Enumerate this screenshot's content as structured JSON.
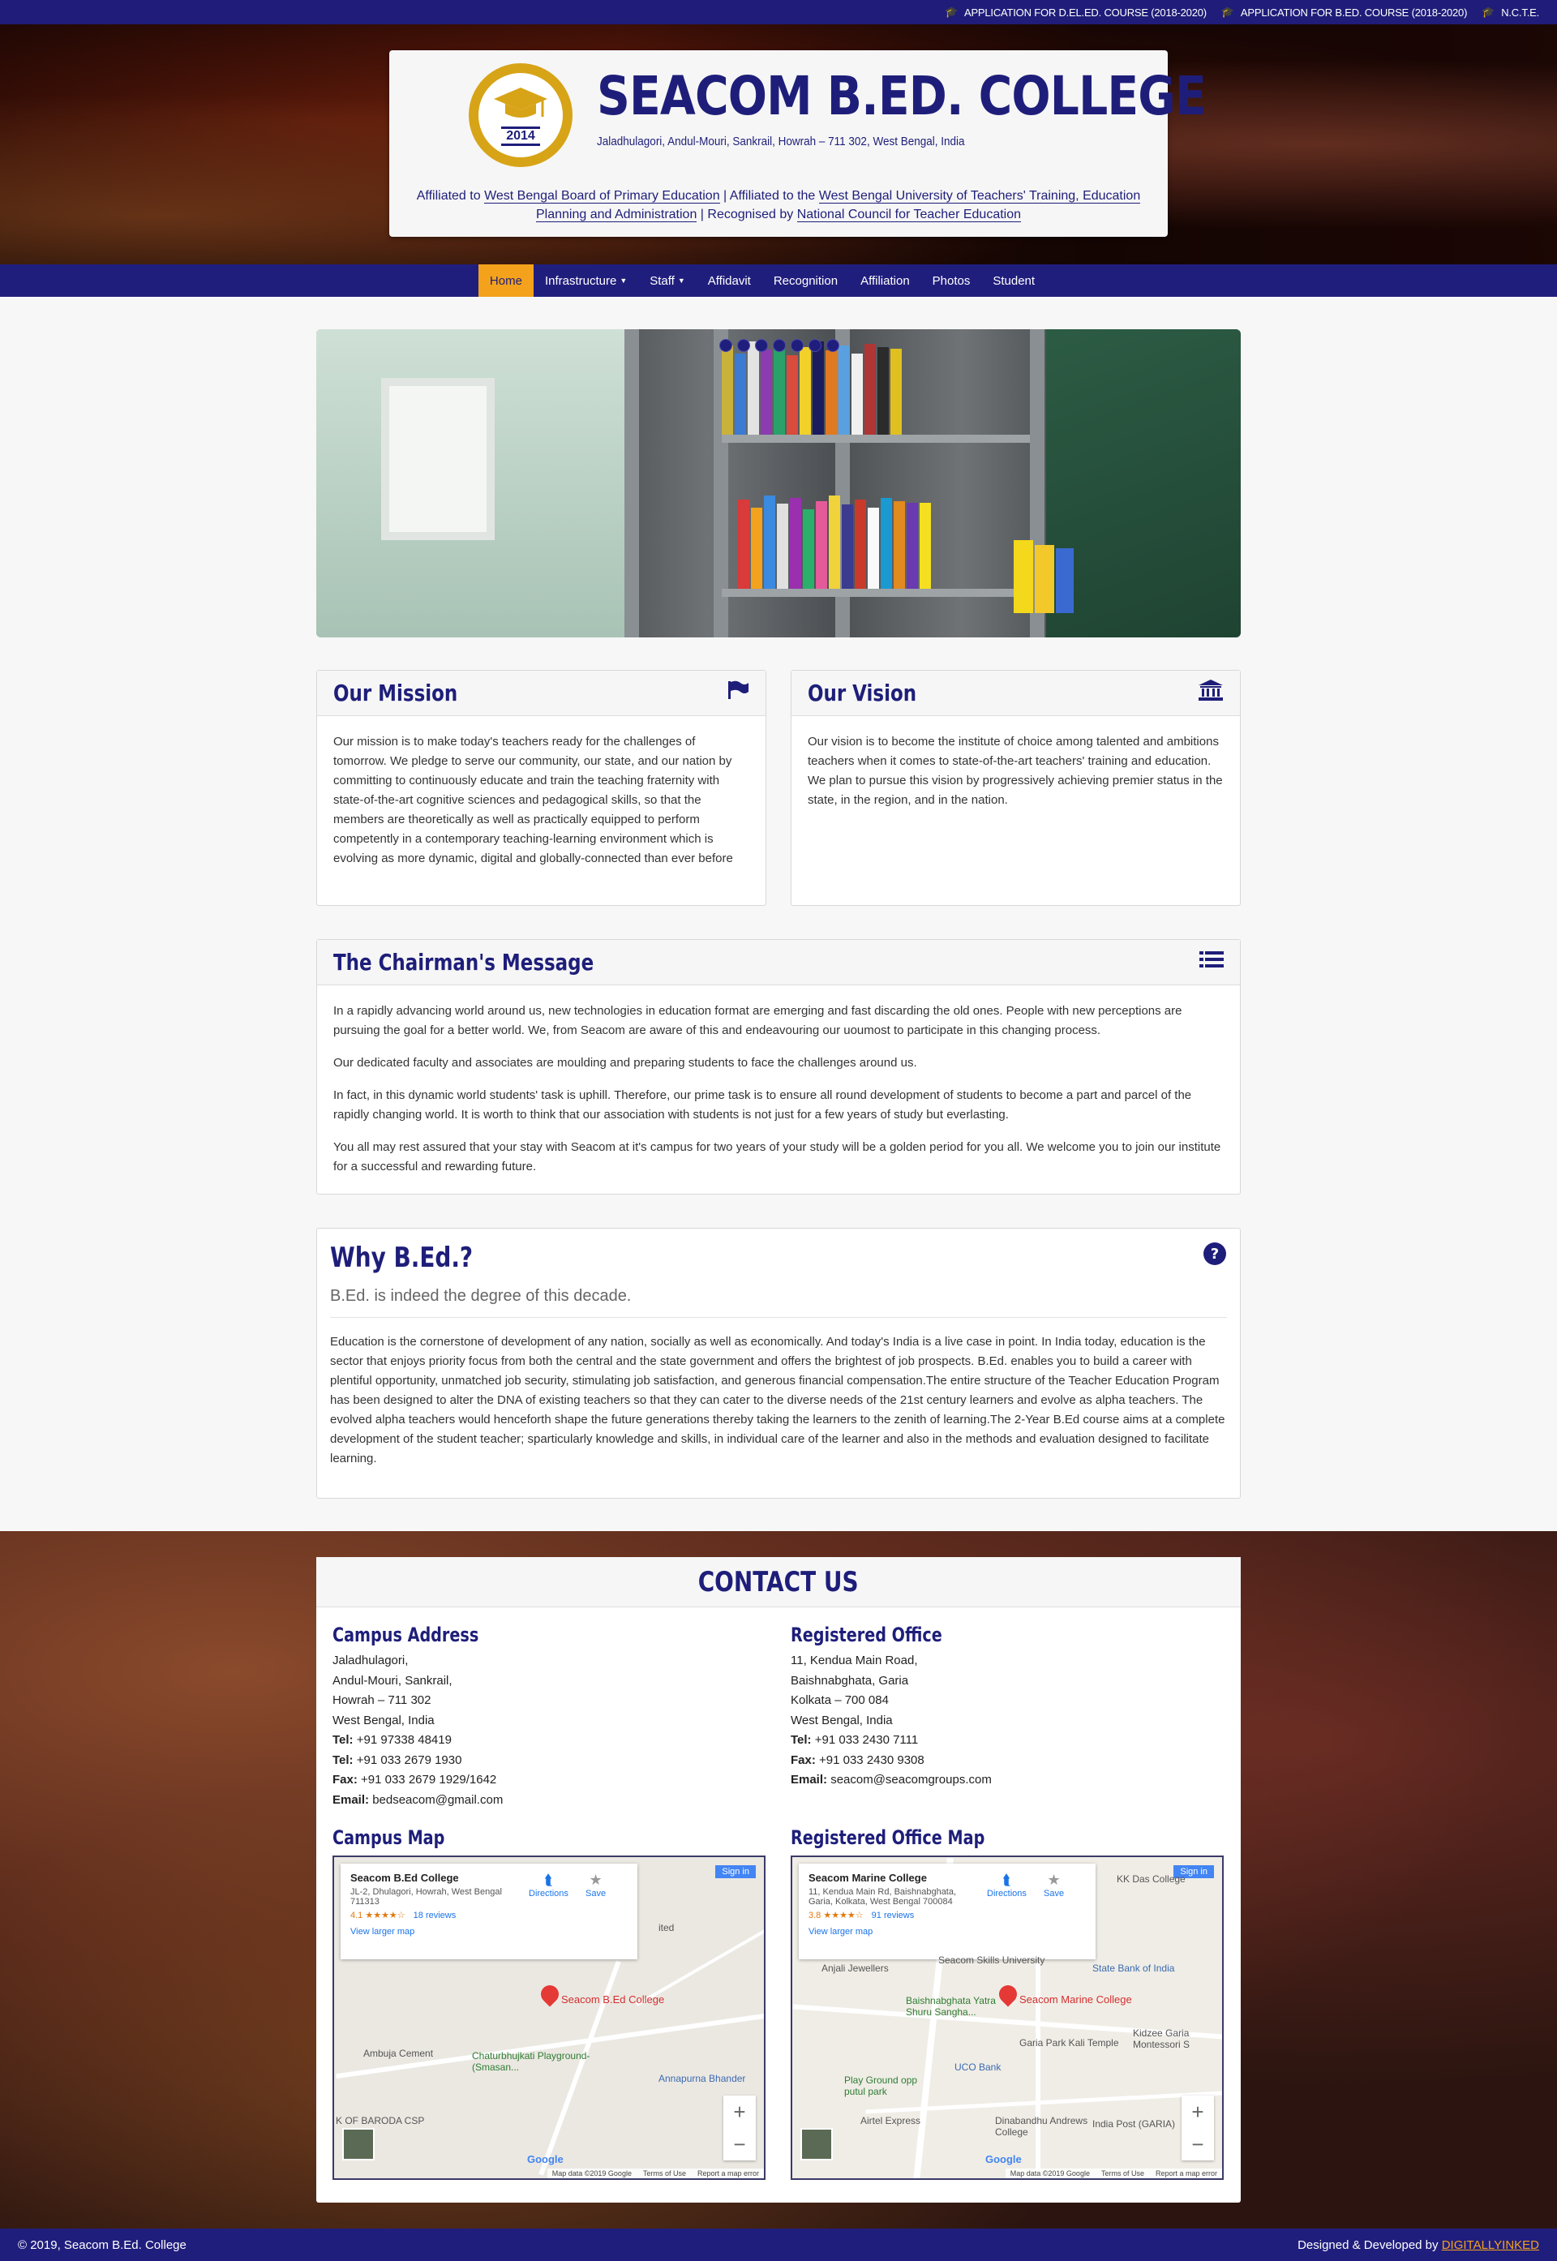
{
  "topbar": {
    "links": [
      {
        "label": "APPLICATION FOR D.EL.ED. COURSE (2018-2020)",
        "icon": "graduation-cap-icon"
      },
      {
        "label": "APPLICATION FOR B.ED. COURSE (2018-2020)",
        "icon": "graduation-cap-icon"
      },
      {
        "label": "N.C.T.E.",
        "icon": "graduation-cap-icon"
      }
    ]
  },
  "header": {
    "logo_year": "2014",
    "college_name": "SEACOM B.ED. COLLEGE",
    "address": "Jaladhulagori, Andul-Mouri, Sankrail, Howrah – 711 302, West Bengal, India",
    "affil_prefix": "Affiliated to",
    "affil_board": "West Bengal Board of Primary Education",
    "affil_mid": "| Affiliated to the",
    "affil_univ": "West Bengal University of Teachers' Training, Education Planning and Administration",
    "affil_mid2": "| Recognised by",
    "affil_council": "National Council for Teacher Education"
  },
  "nav": {
    "items": [
      {
        "label": "Home",
        "active": true
      },
      {
        "label": "Infrastructure",
        "dropdown": true
      },
      {
        "label": "Staff",
        "dropdown": true
      },
      {
        "label": "Affidavit"
      },
      {
        "label": "Recognition"
      },
      {
        "label": "Affiliation"
      },
      {
        "label": "Photos"
      },
      {
        "label": "Student"
      }
    ]
  },
  "slider": {
    "dot_count": 7
  },
  "mission": {
    "title": "Our Mission",
    "icon": "flag-icon",
    "text": "Our mission is to make today's teachers ready for the challenges of tomorrow. We pledge to serve our community, our state, and our nation by committing to continuously educate and train the teaching fraternity with state-of-the-art cognitive sciences and pedagogical skills, so that the members are theoretically as well as practically equipped to perform competently in a contemporary teaching-learning environment which is evolving as more dynamic, digital and globally-connected than ever before"
  },
  "vision": {
    "title": "Our Vision",
    "icon": "institution-icon",
    "text": "Our vision is to become the institute of choice among talented and ambitions teachers when it comes to state-of-the-art teachers' training and education. We plan to pursue this vision by progressively achieving premier status in the state, in the region, and in the nation."
  },
  "chairman": {
    "title": "The Chairman's Message",
    "icon": "list-icon",
    "paragraphs": [
      "In a rapidly advancing world around us, new technologies in education format are emerging and fast discarding the old ones. People with new perceptions are pursuing the goal for a better world. We, from Seacom are aware of this and endeavouring our uoumost to participate in this changing process.",
      "Our dedicated faculty and associates are moulding and preparing students to face the challenges around us.",
      "In fact, in this dynamic world students' task is uphill. Therefore, our prime task is to ensure all round development of students to become a part and parcel of the rapidly changing world. It is worth to think that our association with students is not just for a few years of study but everlasting.",
      "You all may rest assured that your stay with Seacom at it's campus for two years of your study will be a golden period for you all. We welcome you to join our institute for a successful and rewarding future."
    ]
  },
  "why": {
    "title": "Why B.Ed.?",
    "icon": "question-circle-icon",
    "subtitle": "B.Ed. is indeed the degree of this decade.",
    "text": "Education is the cornerstone of development of any nation, socially as well as economically. And today's India is a live case in point. In India today, education is the sector that enjoys priority focus from both the central and the state government and offers the brightest of job prospects. B.Ed. enables you to build a career with plentiful opportunity, unmatched job security, stimulating job satisfaction, and generous financial compensation.The entire structure of the Teacher Education Program has been designed to alter the DNA of existing teachers so that they can cater to the diverse needs of the 21st century learners and evolve as alpha teachers. The evolved alpha teachers would henceforth shape the future generations thereby taking the learners to the zenith of learning.The 2-Year B.Ed course aims at a complete development of the student teacher; sparticularly knowledge and skills, in individual care of the learner and also in the methods and evaluation designed to facilitate learning."
  },
  "contact": {
    "title": "CONTACT US",
    "campus": {
      "title": "Campus Address",
      "lines": [
        "Jaladhulagori,",
        "Andul-Mouri, Sankrail,",
        "Howrah – 711 302",
        "West Bengal, India"
      ],
      "tel1_label": "Tel:",
      "tel1": "+91 97338 48419",
      "tel2_label": "Tel:",
      "tel2": "+91 033 2679 1930",
      "fax_label": "Fax:",
      "fax": "+91 033 2679 1929/1642",
      "email_label": "Email:",
      "email": "bedseacom@gmail.com",
      "map_title": "Campus Map"
    },
    "office": {
      "title": "Registered Office",
      "lines": [
        "11, Kendua Main Road,",
        "Baishnabghata, Garia",
        "Kolkata – 700 084",
        "West Bengal, India"
      ],
      "tel_label": "Tel:",
      "tel": "+91 033 2430 7111",
      "fax_label": "Fax:",
      "fax": "+91 033 2430 9308",
      "email_label": "Email:",
      "email": "seacom@seacomgroups.com",
      "map_title": "Registered Office Map"
    }
  },
  "map1": {
    "place": "Seacom B.Ed College",
    "address": "JL-2, Dhulagori, Howrah, West Bengal 711313",
    "rating": "4.1 ★★★★☆",
    "reviews": "18 reviews",
    "larger": "View larger map",
    "directions": "Directions",
    "save": "Save",
    "signin": "Sign in",
    "pin_label": "Seacom B.Ed College",
    "labels": [
      "Ambuja Cement",
      "Chaturbhujkati Playground- (Smasan...",
      "Annapurna Bhander",
      "K OF BARODA CSP",
      "ited"
    ],
    "google": "Google",
    "foot": [
      "Map data ©2019 Google",
      "Terms of Use",
      "Report a map error"
    ]
  },
  "map2": {
    "place": "Seacom Marine College",
    "address": "11, Kendua Main Rd, Baishnabghata, Garia, Kolkata, West Bengal 700084",
    "rating": "3.8 ★★★★☆",
    "reviews": "91 reviews",
    "larger": "View larger map",
    "directions": "Directions",
    "save": "Save",
    "signin": "Sign in",
    "pin_label": "Seacom Marine College",
    "labels": [
      "KK Das College",
      "State Bank of India",
      "Anjali Jewellers",
      "Baishnabghata Yatra Shuru Sangha...",
      "Garia Park Kali Temple",
      "Kidzee Garia Montessori S",
      "Play Ground opp putul park",
      "UCO Bank",
      "Airtel Express",
      "Dinabandhu Andrews College",
      "India Post (GARIA)",
      "Seacom Skills University"
    ],
    "google": "Google",
    "foot": [
      "Map data ©2019 Google",
      "Terms of Use",
      "Report a map error"
    ]
  },
  "footer": {
    "copyright": "© 2019, Seacom B.Ed. College",
    "designed": "Designed & Developed by",
    "developer": "DIGITALLYINKED"
  }
}
